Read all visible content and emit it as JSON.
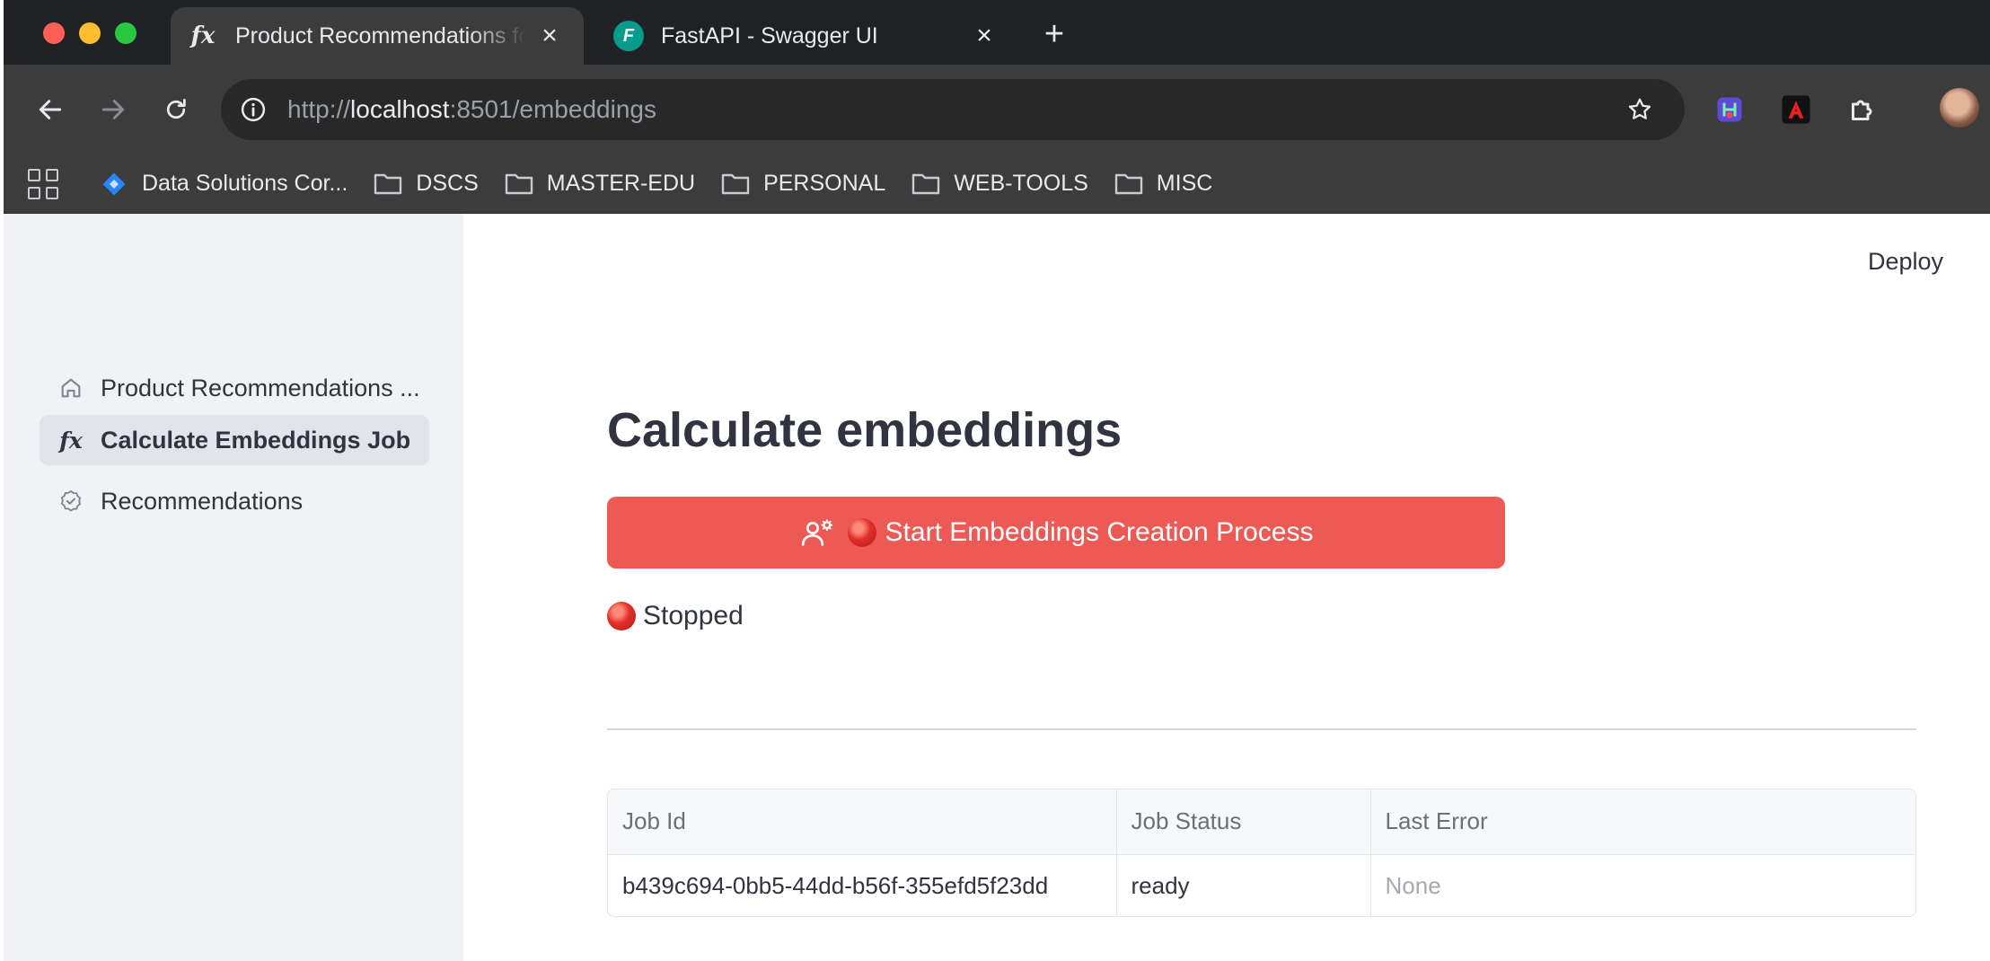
{
  "browser": {
    "tabs": [
      {
        "title": "Product Recommendations fo",
        "icon": "fx-icon",
        "active": true
      },
      {
        "title": "FastAPI - Swagger UI",
        "icon": "fastapi-icon",
        "active": false
      }
    ],
    "url": {
      "scheme": "http://",
      "host": "localhost",
      "rest": ":8501/embeddings"
    },
    "bookmarks": [
      {
        "label": "Data Solutions Cor...",
        "icon": "jira-icon"
      },
      {
        "label": "DSCS",
        "icon": "folder-icon"
      },
      {
        "label": "MASTER-EDU",
        "icon": "folder-icon"
      },
      {
        "label": "PERSONAL",
        "icon": "folder-icon"
      },
      {
        "label": "WEB-TOOLS",
        "icon": "folder-icon"
      },
      {
        "label": "MISC",
        "icon": "folder-icon"
      }
    ]
  },
  "sidebar": {
    "items": [
      {
        "label": "Product Recommendations ...",
        "icon": "home-icon",
        "active": false
      },
      {
        "label": "Calculate Embeddings Job",
        "icon": "fx-icon",
        "active": true
      },
      {
        "label": "Recommendations",
        "icon": "badge-icon",
        "active": false
      }
    ]
  },
  "header": {
    "deploy_label": "Deploy"
  },
  "main": {
    "title": "Calculate embeddings",
    "start_button_label": "Start Embeddings Creation Process",
    "status_text": "Stopped",
    "table": {
      "columns": [
        "Job Id",
        "Job Status",
        "Last Error"
      ],
      "rows": [
        [
          "b439c694-0bb5-44dd-b56f-355efd5f23dd",
          "ready",
          "None"
        ]
      ]
    }
  },
  "colors": {
    "primary_button": "#ed5954",
    "sidebar_bg": "#f0f2f6",
    "text": "#31333f",
    "chrome_bg": "#3c3c3c",
    "tabstrip_bg": "#202124"
  }
}
